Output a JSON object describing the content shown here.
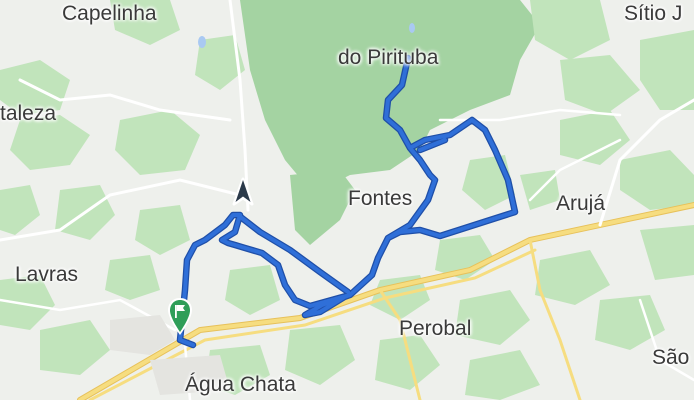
{
  "map": {
    "places": {
      "capelinha": "Capelinha",
      "sitio": "Sítio J",
      "pirituba": "do Pirituba",
      "taleza": "taleza",
      "fontes": "Fontes",
      "aruja": "Arujá",
      "lavras": "Lavras",
      "perobal": "Perobal",
      "agua_chata": "Água Chata",
      "sao": "São"
    },
    "route_color": "#2f6fd8",
    "forest_color": "#a4d3a2",
    "woodland_color": "#c1e4bb",
    "road_color": "#f3d36a",
    "marker_start": "start-location-arrow-icon",
    "marker_end": "finish-flag-pin-icon"
  }
}
